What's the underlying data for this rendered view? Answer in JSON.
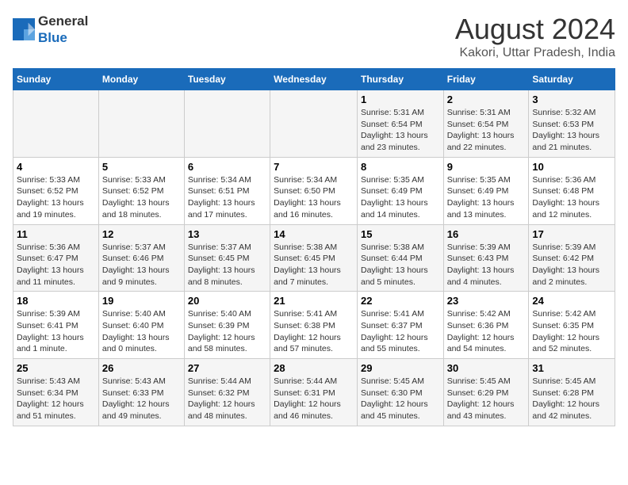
{
  "header": {
    "logo_general": "General",
    "logo_blue": "Blue",
    "month_title": "August 2024",
    "location": "Kakori, Uttar Pradesh, India"
  },
  "days_of_week": [
    "Sunday",
    "Monday",
    "Tuesday",
    "Wednesday",
    "Thursday",
    "Friday",
    "Saturday"
  ],
  "weeks": [
    [
      {
        "day": "",
        "info": ""
      },
      {
        "day": "",
        "info": ""
      },
      {
        "day": "",
        "info": ""
      },
      {
        "day": "",
        "info": ""
      },
      {
        "day": "1",
        "info": "Sunrise: 5:31 AM\nSunset: 6:54 PM\nDaylight: 13 hours and 23 minutes."
      },
      {
        "day": "2",
        "info": "Sunrise: 5:31 AM\nSunset: 6:54 PM\nDaylight: 13 hours and 22 minutes."
      },
      {
        "day": "3",
        "info": "Sunrise: 5:32 AM\nSunset: 6:53 PM\nDaylight: 13 hours and 21 minutes."
      }
    ],
    [
      {
        "day": "4",
        "info": "Sunrise: 5:33 AM\nSunset: 6:52 PM\nDaylight: 13 hours and 19 minutes."
      },
      {
        "day": "5",
        "info": "Sunrise: 5:33 AM\nSunset: 6:52 PM\nDaylight: 13 hours and 18 minutes."
      },
      {
        "day": "6",
        "info": "Sunrise: 5:34 AM\nSunset: 6:51 PM\nDaylight: 13 hours and 17 minutes."
      },
      {
        "day": "7",
        "info": "Sunrise: 5:34 AM\nSunset: 6:50 PM\nDaylight: 13 hours and 16 minutes."
      },
      {
        "day": "8",
        "info": "Sunrise: 5:35 AM\nSunset: 6:49 PM\nDaylight: 13 hours and 14 minutes."
      },
      {
        "day": "9",
        "info": "Sunrise: 5:35 AM\nSunset: 6:49 PM\nDaylight: 13 hours and 13 minutes."
      },
      {
        "day": "10",
        "info": "Sunrise: 5:36 AM\nSunset: 6:48 PM\nDaylight: 13 hours and 12 minutes."
      }
    ],
    [
      {
        "day": "11",
        "info": "Sunrise: 5:36 AM\nSunset: 6:47 PM\nDaylight: 13 hours and 11 minutes."
      },
      {
        "day": "12",
        "info": "Sunrise: 5:37 AM\nSunset: 6:46 PM\nDaylight: 13 hours and 9 minutes."
      },
      {
        "day": "13",
        "info": "Sunrise: 5:37 AM\nSunset: 6:45 PM\nDaylight: 13 hours and 8 minutes."
      },
      {
        "day": "14",
        "info": "Sunrise: 5:38 AM\nSunset: 6:45 PM\nDaylight: 13 hours and 7 minutes."
      },
      {
        "day": "15",
        "info": "Sunrise: 5:38 AM\nSunset: 6:44 PM\nDaylight: 13 hours and 5 minutes."
      },
      {
        "day": "16",
        "info": "Sunrise: 5:39 AM\nSunset: 6:43 PM\nDaylight: 13 hours and 4 minutes."
      },
      {
        "day": "17",
        "info": "Sunrise: 5:39 AM\nSunset: 6:42 PM\nDaylight: 13 hours and 2 minutes."
      }
    ],
    [
      {
        "day": "18",
        "info": "Sunrise: 5:39 AM\nSunset: 6:41 PM\nDaylight: 13 hours and 1 minute."
      },
      {
        "day": "19",
        "info": "Sunrise: 5:40 AM\nSunset: 6:40 PM\nDaylight: 13 hours and 0 minutes."
      },
      {
        "day": "20",
        "info": "Sunrise: 5:40 AM\nSunset: 6:39 PM\nDaylight: 12 hours and 58 minutes."
      },
      {
        "day": "21",
        "info": "Sunrise: 5:41 AM\nSunset: 6:38 PM\nDaylight: 12 hours and 57 minutes."
      },
      {
        "day": "22",
        "info": "Sunrise: 5:41 AM\nSunset: 6:37 PM\nDaylight: 12 hours and 55 minutes."
      },
      {
        "day": "23",
        "info": "Sunrise: 5:42 AM\nSunset: 6:36 PM\nDaylight: 12 hours and 54 minutes."
      },
      {
        "day": "24",
        "info": "Sunrise: 5:42 AM\nSunset: 6:35 PM\nDaylight: 12 hours and 52 minutes."
      }
    ],
    [
      {
        "day": "25",
        "info": "Sunrise: 5:43 AM\nSunset: 6:34 PM\nDaylight: 12 hours and 51 minutes."
      },
      {
        "day": "26",
        "info": "Sunrise: 5:43 AM\nSunset: 6:33 PM\nDaylight: 12 hours and 49 minutes."
      },
      {
        "day": "27",
        "info": "Sunrise: 5:44 AM\nSunset: 6:32 PM\nDaylight: 12 hours and 48 minutes."
      },
      {
        "day": "28",
        "info": "Sunrise: 5:44 AM\nSunset: 6:31 PM\nDaylight: 12 hours and 46 minutes."
      },
      {
        "day": "29",
        "info": "Sunrise: 5:45 AM\nSunset: 6:30 PM\nDaylight: 12 hours and 45 minutes."
      },
      {
        "day": "30",
        "info": "Sunrise: 5:45 AM\nSunset: 6:29 PM\nDaylight: 12 hours and 43 minutes."
      },
      {
        "day": "31",
        "info": "Sunrise: 5:45 AM\nSunset: 6:28 PM\nDaylight: 12 hours and 42 minutes."
      }
    ]
  ]
}
